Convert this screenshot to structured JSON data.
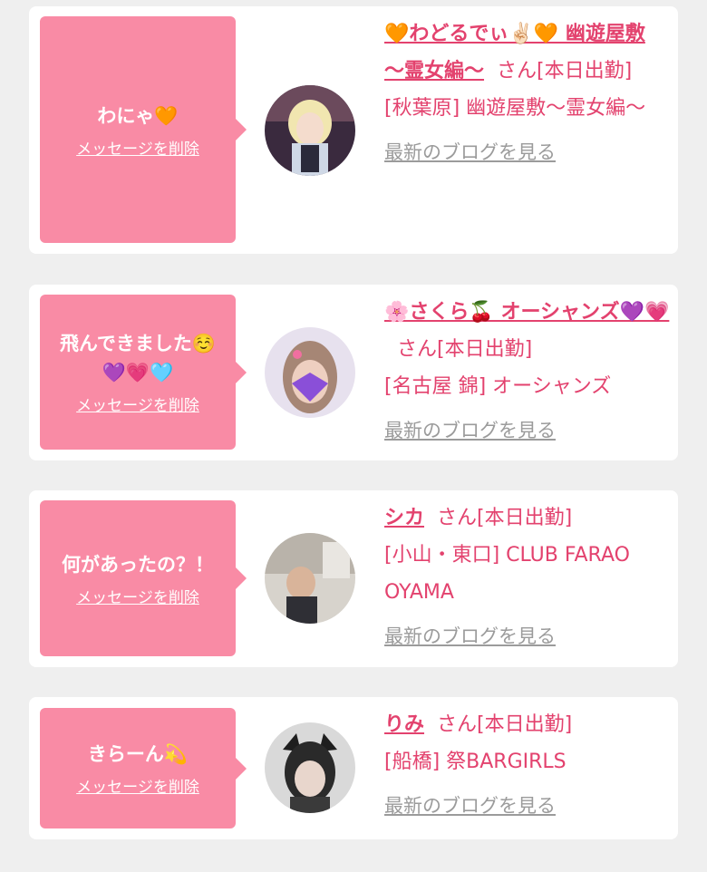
{
  "delete_label": "メッセージを削除",
  "blog_label": "最新のブログを見る",
  "san_label": "さん",
  "colors": {
    "accent": "#e3426e",
    "bubble": "#f98ba5",
    "background": "#efefef"
  },
  "items": [
    {
      "message": "わにゃ🧡",
      "name": "🧡わどるでぃ✌🏻🧡 幽遊屋敷 〜霊女編〜",
      "status": "[本日出勤]",
      "shop": "[秋葉原] 幽遊屋敷〜霊女編〜",
      "avatar_icon": "avatar-photo"
    },
    {
      "message": "飛んできました☺️\n💜💗🩵",
      "name": "🌸さくら🍒 オーシャンズ💜💗",
      "status": "[本日出勤]",
      "shop": "[名古屋 錦] オーシャンズ",
      "avatar_icon": "avatar-photo"
    },
    {
      "message": "何があったの？！",
      "name": "シカ",
      "status": "[本日出勤]",
      "shop": "[小山・東口] CLUB FARAO OYAMA",
      "avatar_icon": "avatar-photo"
    },
    {
      "message": "きらーん💫",
      "name": "りみ",
      "status": "[本日出勤]",
      "shop": "[船橋] 祭BARGIRLS",
      "avatar_icon": "avatar-photo"
    }
  ]
}
